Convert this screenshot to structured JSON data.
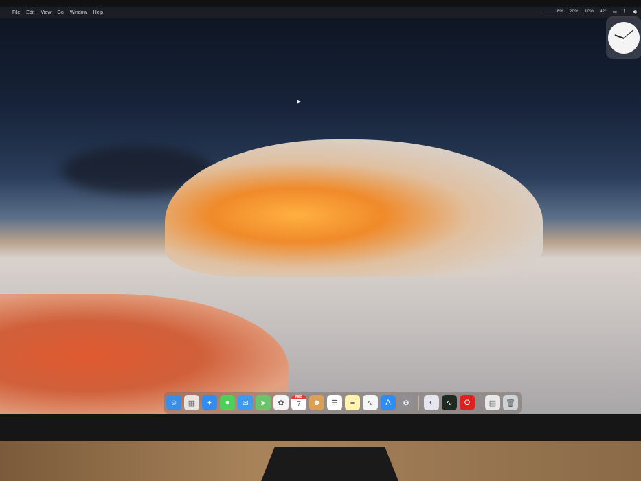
{
  "menubar": {
    "items": [
      "File",
      "Edit",
      "View",
      "Go",
      "Window",
      "Help"
    ],
    "status": {
      "cpu": "8%",
      "memory": "20%",
      "disk": "10%",
      "temperature": "42°"
    }
  },
  "dock": {
    "apps": [
      {
        "name": "finder",
        "glyph": "☺",
        "color": "#3a8ee6"
      },
      {
        "name": "launchpad",
        "glyph": "▦",
        "color": "#e8e4df"
      },
      {
        "name": "safari",
        "glyph": "✦",
        "color": "#2f8cf0"
      },
      {
        "name": "messages",
        "glyph": "●",
        "color": "#4cd05a"
      },
      {
        "name": "mail",
        "glyph": "✉",
        "color": "#3c9bf0"
      },
      {
        "name": "maps",
        "glyph": "➤",
        "color": "#6ac46a"
      },
      {
        "name": "photos",
        "glyph": "✿",
        "color": "#f5f5f5"
      },
      {
        "name": "calendar",
        "glyph": "7",
        "color": "#ffffff"
      },
      {
        "name": "contacts",
        "glyph": "☻",
        "color": "#d9a056"
      },
      {
        "name": "reminders",
        "glyph": "☰",
        "color": "#ffffff"
      },
      {
        "name": "notes",
        "glyph": "≡",
        "color": "#fff3b0"
      },
      {
        "name": "freeform",
        "glyph": "∿",
        "color": "#f5f5f5"
      },
      {
        "name": "app-store",
        "glyph": "A",
        "color": "#2d8df5"
      },
      {
        "name": "system-settings",
        "glyph": "⚙",
        "color": "#8e8e93"
      }
    ],
    "recent": [
      {
        "name": "browser",
        "glyph": "◐",
        "color": "#e6e6f0"
      },
      {
        "name": "activity-monitor",
        "glyph": "∿",
        "color": "#1f2a22"
      },
      {
        "name": "opera",
        "glyph": "O",
        "color": "#e02020"
      }
    ],
    "other": [
      {
        "name": "document",
        "glyph": "▤",
        "color": "#e8e8e8"
      },
      {
        "name": "trash",
        "glyph": "🗑",
        "color": "#cfd3d6"
      }
    ],
    "calendar_month": "FEB",
    "calendar_day": "7"
  }
}
